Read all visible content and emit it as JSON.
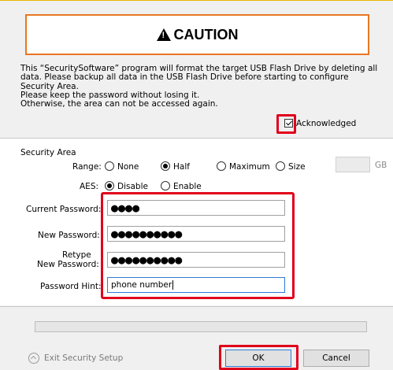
{
  "caution": {
    "icon": "warning-triangle-icon",
    "title": "CAUTION"
  },
  "notice": "This “SecuritySoftware” program will format the target USB Flash Drive by deleting all\ndata. Please backup all data in the USB Flash Drive before starting to configure\nSecurity Area.\nPlease keep the password without losing it.\nOtherwise, the area can not be accessed again.",
  "acknowledge": {
    "label": "Acknowledged",
    "checked": true
  },
  "security_area": {
    "heading": "Security Area",
    "range_label": "Range:",
    "range_options": [
      "None",
      "Half",
      "Maximum",
      "Size"
    ],
    "range_selected": "Half",
    "size_value": "",
    "size_unit": "GB",
    "aes_label": "AES:",
    "aes_options": [
      "Disable",
      "Enable"
    ],
    "aes_selected": "Disable"
  },
  "passwords": {
    "current_label": "Current Password:",
    "current_value": "●●●●",
    "new_label": "New Password:",
    "new_value": "●●●●●●●●●●",
    "retype_label_line1": "Retype",
    "retype_label_line2": "New Password:",
    "retype_value": "●●●●●●●●●●",
    "hint_label": "Password Hint:",
    "hint_value": "phone number"
  },
  "progress": {
    "value": 0
  },
  "footer": {
    "exit_label": "Exit Security Setup",
    "ok_label": "OK",
    "cancel_label": "Cancel"
  },
  "colors": {
    "caution_border": "#e87722",
    "highlight": "#e0001b",
    "focus": "#2c7bd6"
  }
}
